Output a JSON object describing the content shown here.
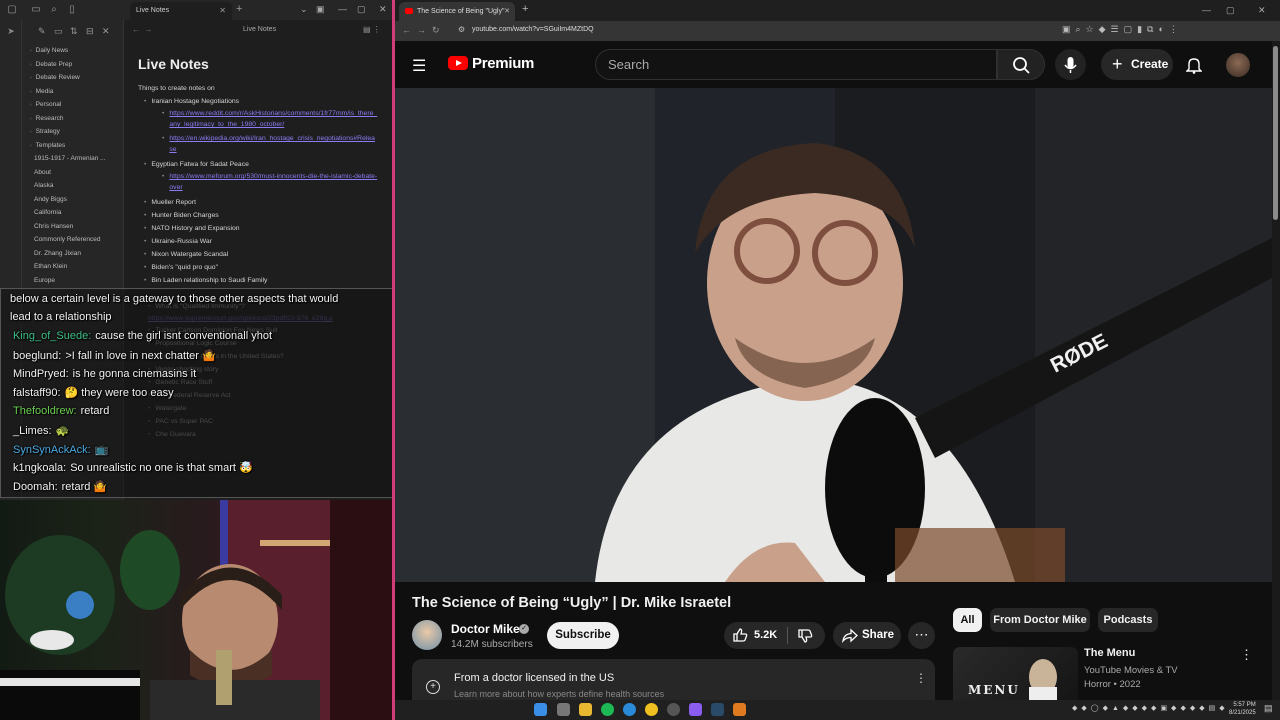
{
  "obsidian": {
    "tab_title": "Live Notes",
    "header_title": "Live Notes",
    "note_title": "Live Notes",
    "folders": [
      "Daily News",
      "Debate Prep",
      "Debate Review",
      "Media",
      "Personal",
      "Research",
      "Strategy",
      "Templates",
      "1915-1917 - Armenian ...",
      "About",
      "Alaska",
      "Andy Biggs",
      "California",
      "Chris Hansen",
      "Commonly Referenced",
      "Dr. Zhang Jixian",
      "Ethan Klein",
      "Europe"
    ],
    "intro": "Things to create notes on",
    "items": [
      {
        "text": "Iranian Hostage Negotiations",
        "links": [
          "https://www.reddit.com/r/AskHistorians/comments/1fr77mm/is_there_any_legitimacy_to_the_1980_october/",
          "https://en.wikipedia.org/wiki/Iran_hostage_crisis_negotiations#Release"
        ]
      },
      {
        "text": "Egyptian Fatwa for Sadat Peace",
        "links": [
          "https://www.meforum.org/530/must-innocents-die-the-islamic-debate-over"
        ]
      },
      {
        "text": "Mueller Report"
      },
      {
        "text": "Hunter Biden Charges"
      },
      {
        "text": "NATO History and Expansion"
      },
      {
        "text": "Ukraine-Russia War"
      },
      {
        "text": "Nixon Watergate Scandal"
      },
      {
        "text": "Biden's \"quid pro quo\""
      },
      {
        "text": "Bin Laden relationship to Saudi Family"
      }
    ],
    "hidden_items": [
      "What is \"Qualified Immunity\"?",
      "https://www.supremecourt.gov/opinions/23pdf/22-976_e29g.p",
      "Tucker Carlson Dominion Fox News Suit",
      "Propositional Logic Course",
      "Who classifies things in the United States?",
      "Vegas shooting story",
      "Genetic Race Stuff",
      "The Federal Reserve Act",
      "Watergate",
      "PAC vs Super PAC",
      "Che Guevara"
    ]
  },
  "chat": {
    "lines": [
      {
        "user": "",
        "text": "below a certain level is a gateway to those other aspects that would",
        "color": "#f2f2f2"
      },
      {
        "user": "",
        "text": "lead to a relationship",
        "color": "#f2f2f2"
      },
      {
        "user": "King_of_Suede:",
        "text": "cause the girl isnt conventionall yhot",
        "color": "#3fbf8a"
      },
      {
        "user": "boeglund:",
        "text": ">I fall in love in next chatter 🤷",
        "color": "#f2f2f2"
      },
      {
        "user": "MindPryed:",
        "text": "is he gonna cinemasins it",
        "color": "#f2f2f2"
      },
      {
        "user": "falstaff90:",
        "text": "🤔 they were too easy",
        "color": "#f2f2f2"
      },
      {
        "user": "Thefooldrew:",
        "text": "retard",
        "color": "#6ccf52"
      },
      {
        "user": "_Limes:",
        "text": "🐢",
        "color": "#f2f2f2"
      },
      {
        "user": "SynSynAckAck:",
        "text": "📺",
        "color": "#4aa8e0"
      },
      {
        "user": "k1ngkoala:",
        "text": "So unrealistic no one is that smart 🤯",
        "color": "#f2f2f2"
      },
      {
        "user": "Doomah:",
        "text": "retard 🤷",
        "color": "#f2f2f2"
      }
    ]
  },
  "browser": {
    "tab_title": "The Science of Being \"Ugly\"",
    "url": "youtube.com/watch?v=SGuiIm4MZtDQ"
  },
  "youtube": {
    "brand": "Premium",
    "search_placeholder": "Search",
    "create_label": "Create",
    "video_title": "The Science of Being “Ugly” | Dr. Mike Israetel",
    "channel_name": "Doctor Mike",
    "subscribers": "14.2M subscribers",
    "subscribe_label": "Subscribe",
    "like_count": "5.2K",
    "share_label": "Share",
    "notice_title": "From a doctor licensed in the US",
    "notice_sub": "Learn more about how experts define health sources",
    "chips": [
      "All",
      "From Doctor Mike",
      "Podcasts"
    ],
    "rec_title": "The Menu",
    "rec_channel": "YouTube Movies & TV",
    "rec_meta": "Horror • 2022",
    "rec_thumb_text": "MENU",
    "player_brand": "RØDE"
  },
  "taskbar": {
    "time": "5:57 PM",
    "date": "8/21/2025"
  }
}
